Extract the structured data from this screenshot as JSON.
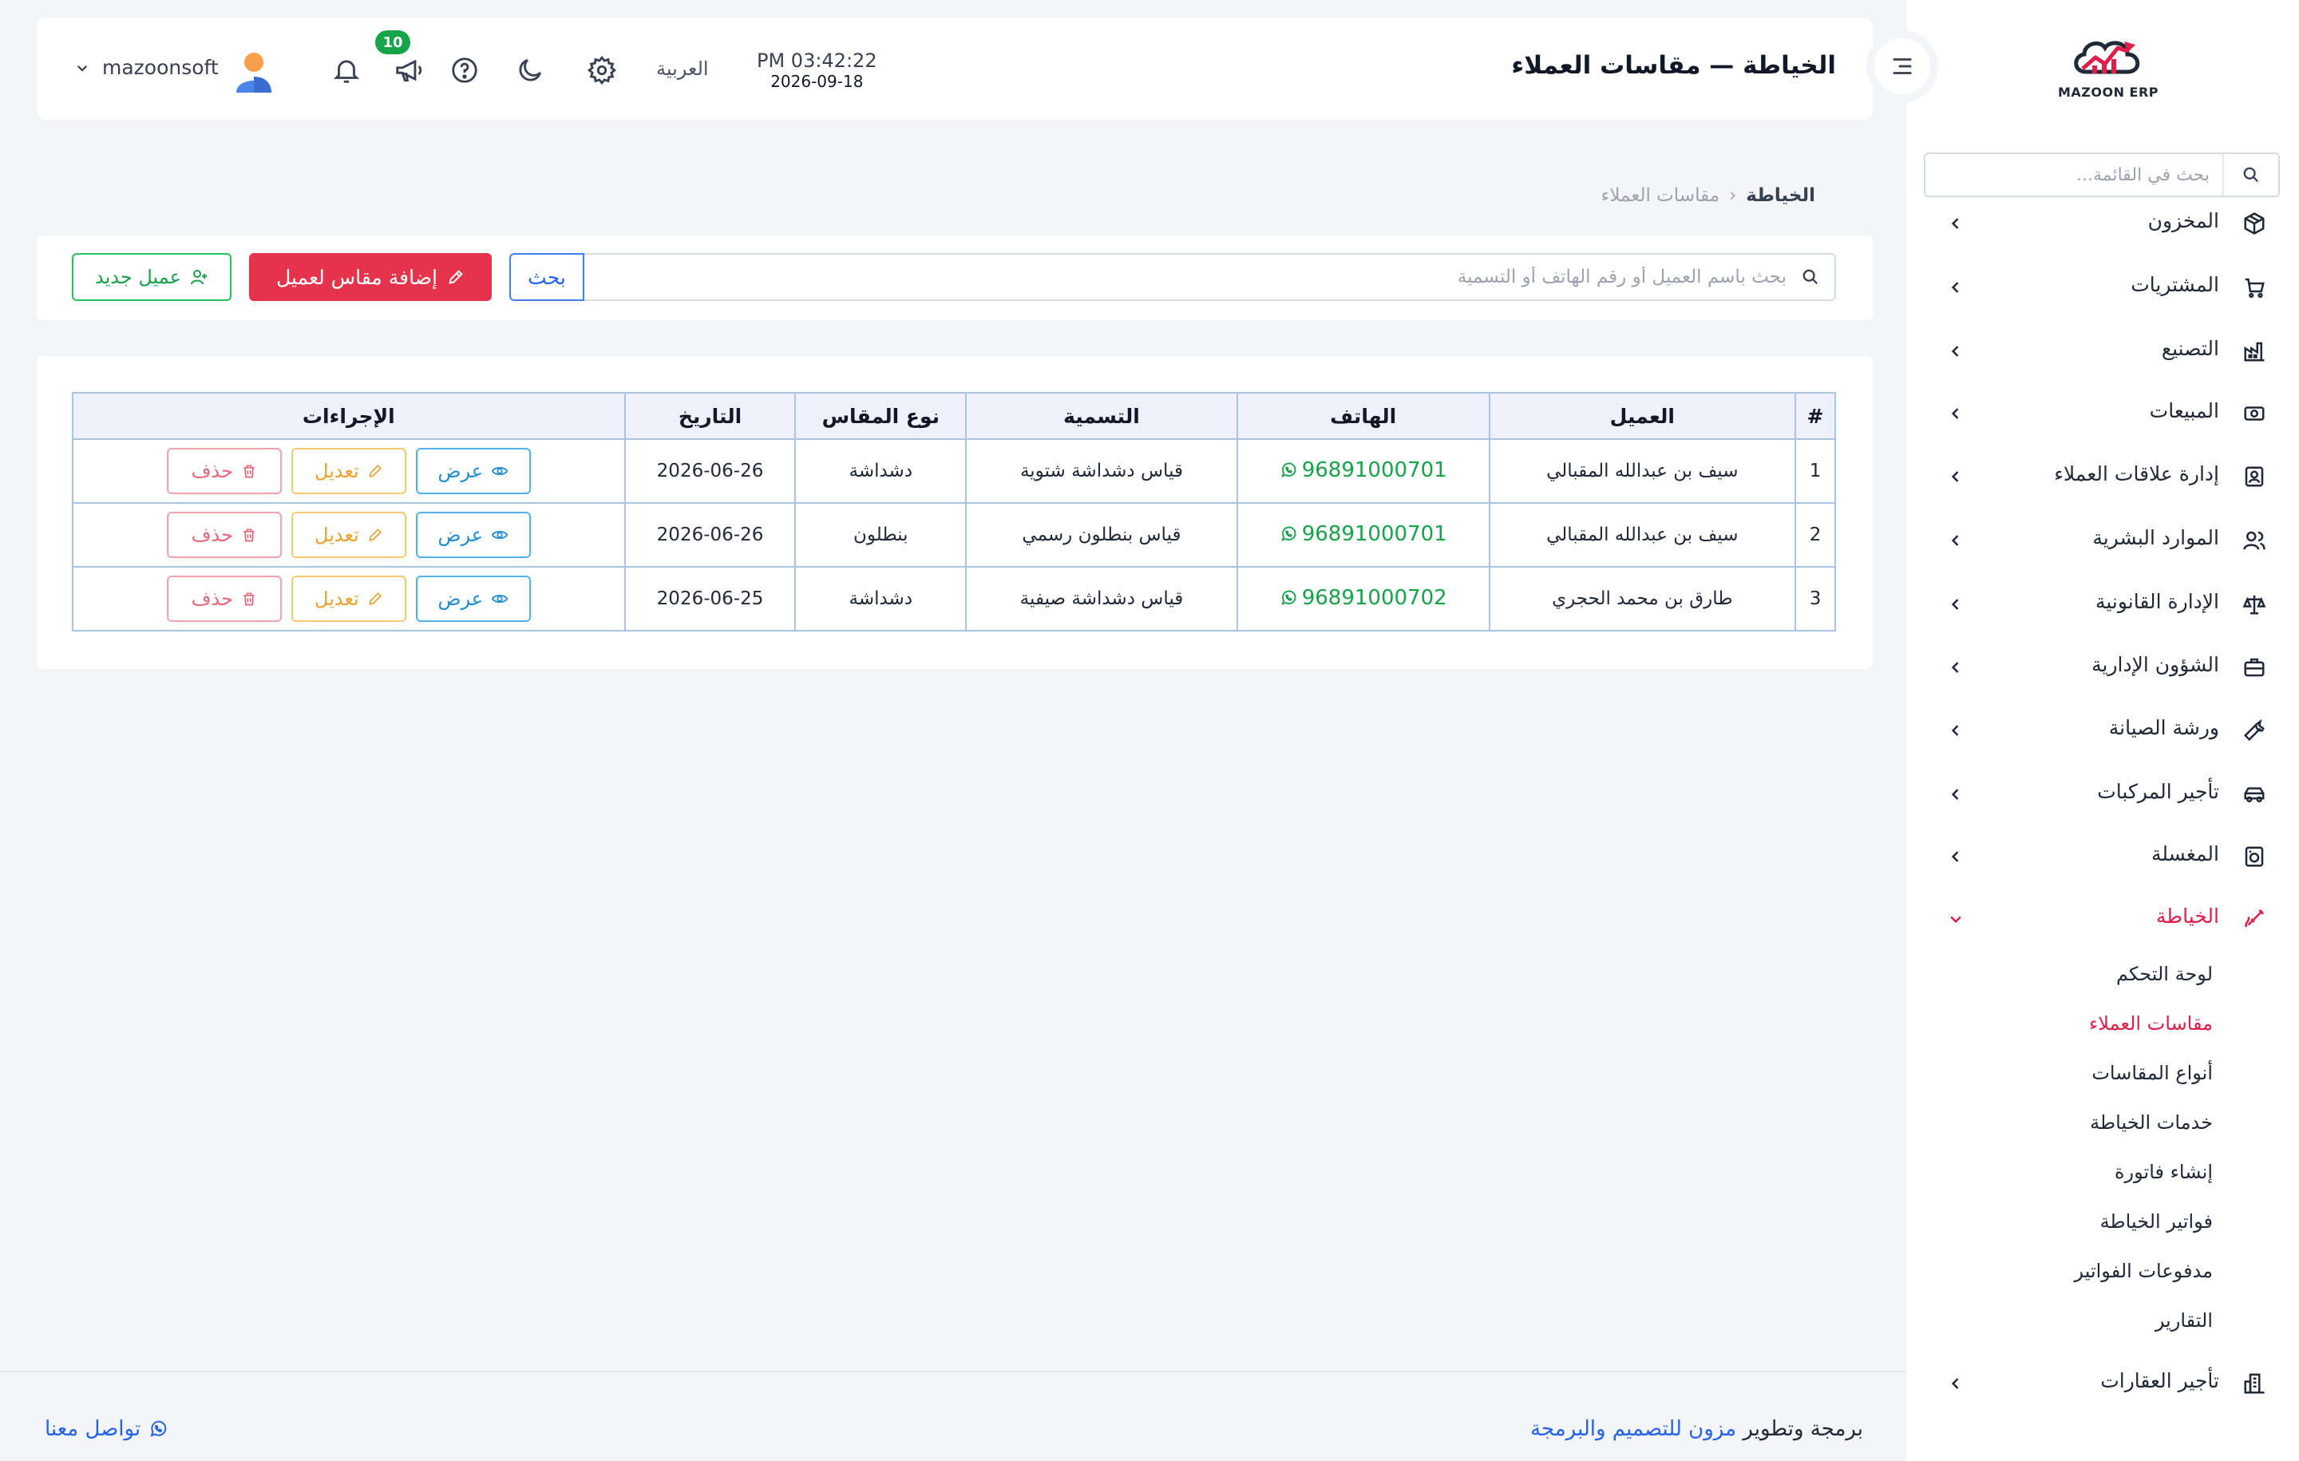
{
  "header": {
    "title": "الخياطة — مقاسات العملاء",
    "time": "PM 03:42:22",
    "date": "2026-09-18",
    "language": "العربية",
    "notification_count": "10",
    "username": "mazoonsoft"
  },
  "logo": {
    "text": "MAZOON ERP"
  },
  "sidebar": {
    "search_placeholder": "بحث في القائمة...",
    "items": [
      {
        "label": "المخزون",
        "icon": "box-icon"
      },
      {
        "label": "المشتريات",
        "icon": "cart-icon"
      },
      {
        "label": "التصنيع",
        "icon": "factory-icon"
      },
      {
        "label": "المبيعات",
        "icon": "cash-icon"
      },
      {
        "label": "إدارة علاقات العملاء",
        "icon": "contact-card-icon"
      },
      {
        "label": "الموارد البشرية",
        "icon": "users-icon"
      },
      {
        "label": "الإدارة القانونية",
        "icon": "scale-icon"
      },
      {
        "label": "الشؤون الإدارية",
        "icon": "briefcase-icon"
      },
      {
        "label": "ورشة الصيانة",
        "icon": "wrench-icon"
      },
      {
        "label": "تأجير المركبات",
        "icon": "car-icon"
      },
      {
        "label": "المغسلة",
        "icon": "washer-icon"
      },
      {
        "label": "الخياطة",
        "icon": "needle-icon"
      },
      {
        "label": "تأجير العقارات",
        "icon": "building-icon"
      }
    ],
    "sub_items": [
      "لوحة التحكم",
      "مقاسات العملاء",
      "أنواع المقاسات",
      "خدمات الخياطة",
      "إنشاء فاتورة",
      "فواتير الخياطة",
      "مدفوعات الفواتير",
      "التقارير"
    ],
    "active_color": "#e11d48"
  },
  "breadcrumb": {
    "home": "الخياطة",
    "current": "مقاسات العملاء"
  },
  "toolbar": {
    "search_placeholder": "بحث باسم العميل أو رقم الهاتف أو التسمية",
    "search_button": "بحث",
    "add_measure_button": "إضافة مقاس لعميل",
    "new_client_button": "عميل جديد"
  },
  "table": {
    "headers": [
      "#",
      "العميل",
      "الهاتف",
      "التسمية",
      "نوع المقاس",
      "التاريخ",
      "الإجراءات"
    ],
    "rows": [
      {
        "n": "1",
        "client": "سيف بن عبدالله المقبالي",
        "phone": "96891000701",
        "label": "قياس دشداشة شتوية",
        "type": "دشداشة",
        "date": "2026-06-26"
      },
      {
        "n": "2",
        "client": "سيف بن عبدالله المقبالي",
        "phone": "96891000701",
        "label": "قياس بنطلون رسمي",
        "type": "بنطلون",
        "date": "2026-06-26"
      },
      {
        "n": "3",
        "client": "طارق بن محمد الحجري",
        "phone": "96891000702",
        "label": "قياس دشداشة صيفية",
        "type": "دشداشة",
        "date": "2026-06-25"
      }
    ],
    "actions": {
      "view": "عرض",
      "edit": "تعديل",
      "delete": "حذف"
    }
  },
  "footer": {
    "credit_prefix": "برمجة وتطوير",
    "credit_brand": "مزون للتصميم والبرمجة",
    "contact": "تواصل معنا"
  }
}
